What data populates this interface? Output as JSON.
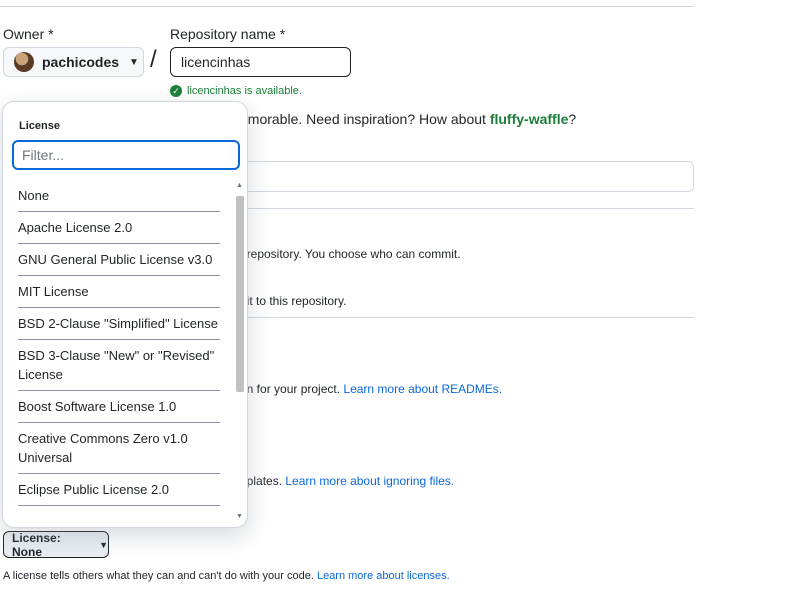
{
  "owner": {
    "label": "Owner *",
    "name": "pachicodes"
  },
  "repo": {
    "label": "Repository name *",
    "value": "licencinhas",
    "availability": "licencinhas is available."
  },
  "hint": {
    "prefix": "emorable. Need inspiration? How about ",
    "suggestion": "fluffy-waffle",
    "suffix": "?"
  },
  "visibility": {
    "public_desc_fragment": "; repository. You choose who can commit.",
    "private_desc_fragment": "nit to this repository."
  },
  "readme": {
    "desc_fragment": "on for your project. ",
    "link": "Learn more about READMEs."
  },
  "gitignore": {
    "desc_fragment": "nplates. ",
    "link": "Learn more about ignoring files."
  },
  "license": {
    "button_label": "License: None",
    "help_text": "A license tells others what they can and can't do with your code. ",
    "help_link": "Learn more about licenses."
  },
  "license_dropdown": {
    "title": "License",
    "filter_placeholder": "Filter...",
    "items": [
      "None",
      "Apache License 2.0",
      "GNU General Public License v3.0",
      "MIT License",
      "BSD 2-Clause \"Simplified\" License",
      "BSD 3-Clause \"New\" or \"Revised\" License",
      "Boost Software License 1.0",
      "Creative Commons Zero v1.0 Universal",
      "Eclipse Public License 2.0"
    ]
  },
  "colors": {
    "accent": "#0969da",
    "success": "#1a7f37",
    "border": "#d0d7de"
  }
}
